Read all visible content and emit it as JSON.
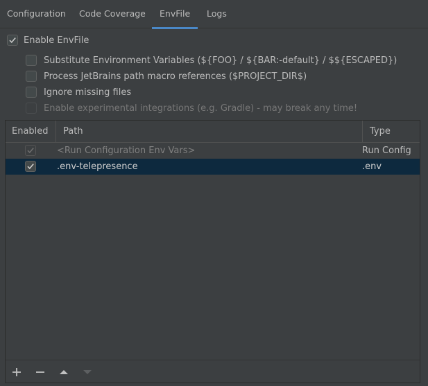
{
  "tabs": [
    {
      "label": "Configuration"
    },
    {
      "label": "Code Coverage"
    },
    {
      "label": "EnvFile"
    },
    {
      "label": "Logs"
    }
  ],
  "options": {
    "enable_envfile": {
      "label": "Enable EnvFile",
      "checked": true
    },
    "substitute": {
      "label": "Substitute Environment Variables (${FOO} / ${BAR:-default} / $${ESCAPED})",
      "checked": false
    },
    "process_macros": {
      "label": "Process JetBrains path macro references ($PROJECT_DIR$)",
      "checked": false
    },
    "ignore_missing": {
      "label": "Ignore missing files",
      "checked": false
    },
    "experimental": {
      "label": "Enable experimental integrations (e.g. Gradle) - may break any time!",
      "checked": false,
      "disabled": true
    }
  },
  "table": {
    "columns": [
      "Enabled",
      "Path",
      "Type"
    ],
    "rows": [
      {
        "enabled": true,
        "path": "<Run Configuration Env Vars>",
        "type": "Run Config",
        "muted": true
      },
      {
        "enabled": true,
        "path": ".env-telepresence",
        "type": ".env",
        "selected": true
      }
    ]
  },
  "toolbar": {
    "add": "plus-icon",
    "remove": "minus-icon",
    "up": "arrow-up-icon",
    "down": "arrow-down-icon"
  },
  "colors": {
    "accent": "#4a88c7",
    "selection": "#0d293e",
    "background": "#3c3f41"
  }
}
